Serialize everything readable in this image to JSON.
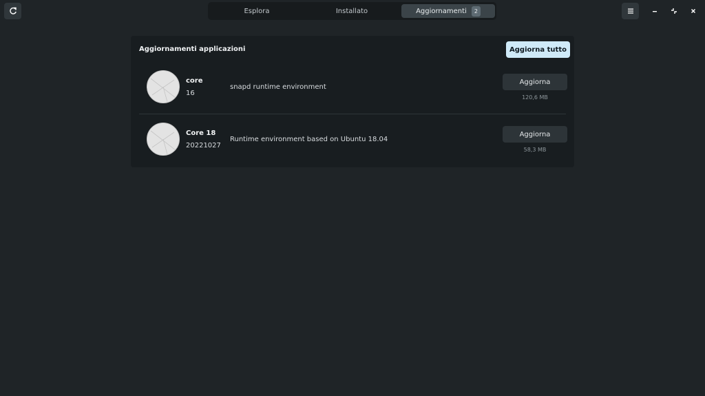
{
  "header": {
    "tabs": [
      {
        "label": "Esplora"
      },
      {
        "label": "Installato"
      },
      {
        "label": "Aggiornamenti",
        "badge": "2"
      }
    ],
    "active_tab": "Aggiornamenti"
  },
  "icons": {
    "refresh": "refresh-icon",
    "menu": "hamburger-menu-icon",
    "minimize": "minimize-icon",
    "restore": "restore-icon",
    "close": "close-icon",
    "app_placeholder": "generic-app-icon"
  },
  "panel": {
    "title": "Aggiornamenti applicazioni",
    "update_all_label": "Aggiorna tutto"
  },
  "updates": [
    {
      "name": "core",
      "version": "16",
      "description": "snapd runtime environment",
      "button": "Aggiorna",
      "size": "120,6 MB"
    },
    {
      "name": "Core 18",
      "version": "20221027",
      "description": "Runtime environment based on Ubuntu 18.04",
      "button": "Aggiorna",
      "size": "58,3 MB"
    }
  ],
  "colors": {
    "background": "#1f2427",
    "panel": "#181d20",
    "accent_button": "#cfeaf8"
  }
}
